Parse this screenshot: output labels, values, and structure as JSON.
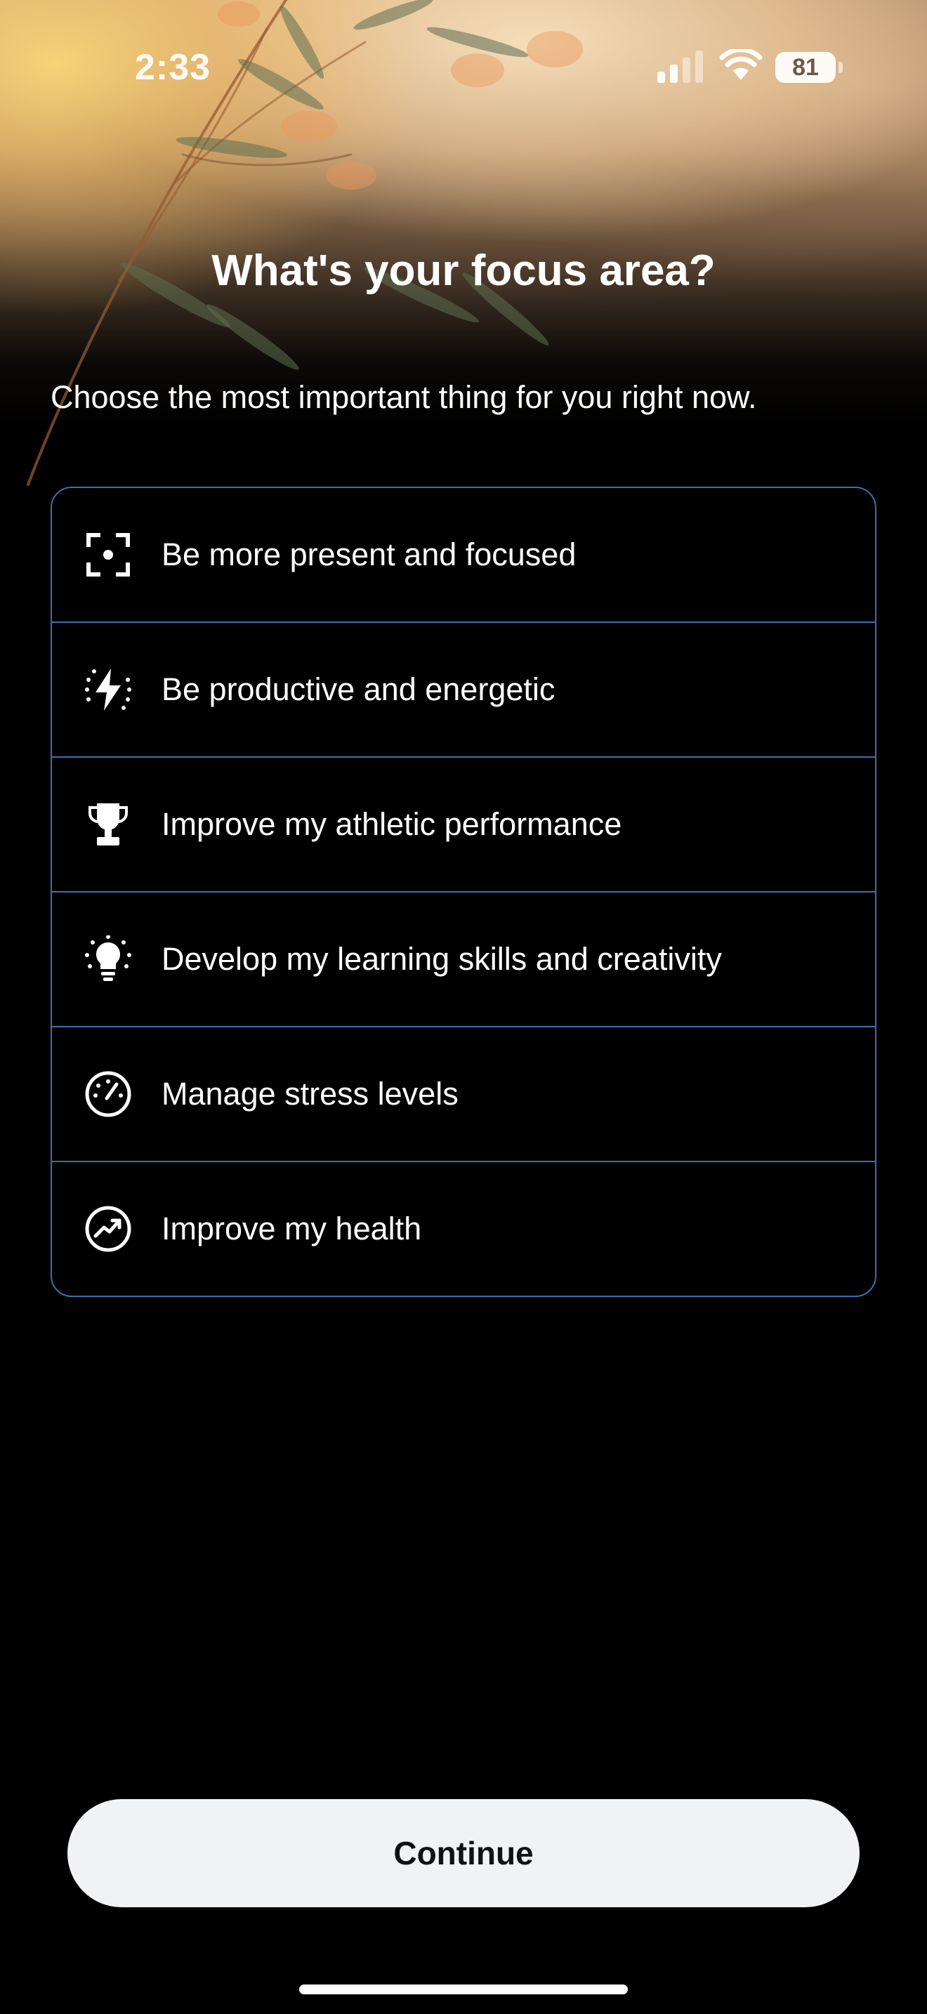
{
  "status_bar": {
    "time": "2:33",
    "battery": "81",
    "signal_icon": "cellular-signal-icon",
    "wifi_icon": "wifi-icon"
  },
  "header": {
    "title": "What's your focus area?",
    "subtitle": "Choose the most important thing for you right now."
  },
  "options": [
    {
      "label": "Be more present and focused",
      "icon": "focus-target-icon"
    },
    {
      "label": "Be productive and energetic",
      "icon": "lightning-bolt-icon"
    },
    {
      "label": "Improve my athletic performance",
      "icon": "trophy-icon"
    },
    {
      "label": "Develop my learning skills and creativity",
      "icon": "lightbulb-icon"
    },
    {
      "label": "Manage stress levels",
      "icon": "gauge-icon"
    },
    {
      "label": "Improve my health",
      "icon": "trending-up-icon"
    }
  ],
  "footer": {
    "continue_label": "Continue"
  },
  "colors": {
    "option_border": "#3a70b0",
    "button_background": "#f1f2f4",
    "background": "#000000"
  }
}
